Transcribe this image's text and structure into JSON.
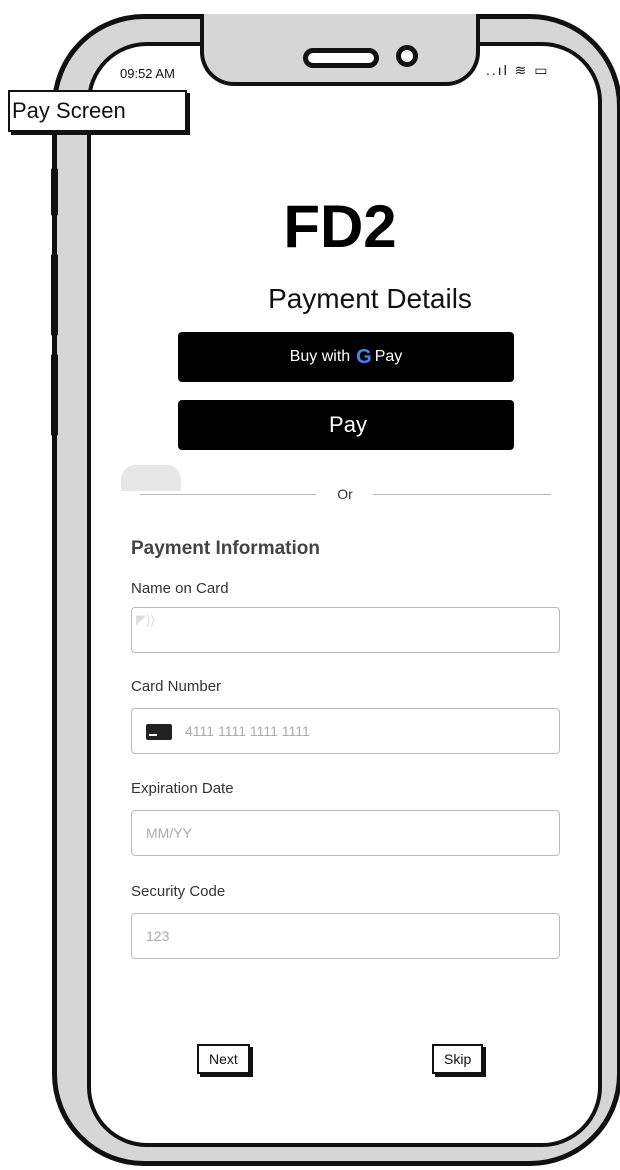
{
  "status_bar": {
    "time": "09:52 AM",
    "icons": "..ıl ≋ ▭"
  },
  "screen_label": "Pay Screen",
  "header": {
    "app_title": "FD2",
    "subtitle": "Payment Details"
  },
  "express_pay": {
    "google_pay": {
      "prefix": "Buy with",
      "g": "G",
      "pay": "Pay"
    },
    "apple_pay": {
      "apple_glyph": "",
      "pay": "Pay"
    }
  },
  "divider_text": "Or",
  "form": {
    "title": "Payment Information",
    "name_on_card": {
      "label": "Name on Card",
      "value": "",
      "placeholder": ""
    },
    "card_number": {
      "label": "Card Number",
      "placeholder": "4111 1111 1111 1111"
    },
    "expiration_date": {
      "label": "Expiration Date",
      "placeholder": "MM/YY"
    },
    "security_code": {
      "label": "Security Code",
      "placeholder": "123"
    }
  },
  "buttons": {
    "next": "Next",
    "skip": "Skip"
  }
}
